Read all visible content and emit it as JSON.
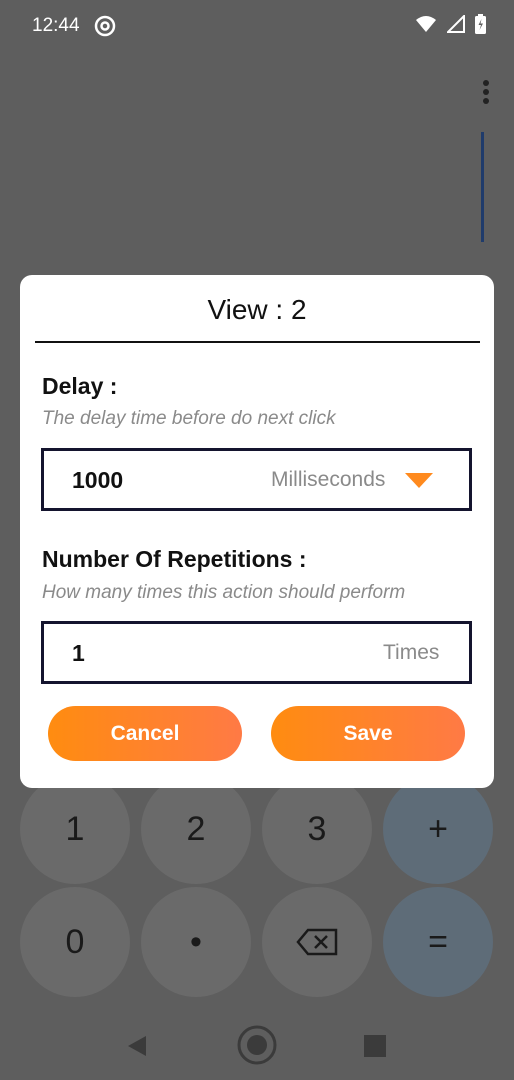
{
  "status": {
    "time": "12:44"
  },
  "keypad": {
    "row1": [
      "1",
      "2",
      "3",
      "+"
    ],
    "row2": [
      "0",
      "•",
      "backspace",
      "="
    ]
  },
  "dialog": {
    "title": "View : 2",
    "delay": {
      "label": "Delay :",
      "hint": "The delay time before do next click",
      "value": "1000",
      "unit": "Milliseconds"
    },
    "repetitions": {
      "label": "Number Of Repetitions :",
      "hint": "How many times this action should perform",
      "value": "1",
      "unit": "Times"
    },
    "cancel_label": "Cancel",
    "save_label": "Save"
  },
  "colors": {
    "accent": "#ff8c10",
    "field_border": "#14142e",
    "overlay": "#5e5e5e"
  }
}
